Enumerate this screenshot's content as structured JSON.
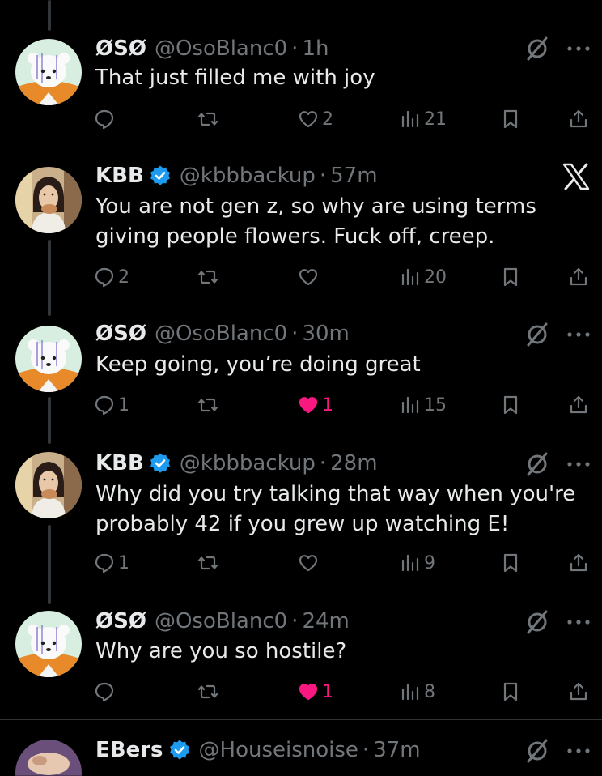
{
  "tweets": [
    {
      "name": "ØSØ",
      "handle": "@OsoBlanc0",
      "sep": "·",
      "time": "1h",
      "text": "That just filled me with joy",
      "replies": "",
      "retweets": "",
      "likes": "2",
      "liked": false,
      "views": "21",
      "corner_icon": "grok-icon"
    },
    {
      "name": "KBB",
      "handle": "@kbbbackup",
      "sep": "·",
      "time": "57m",
      "text": "You are not gen z, so why are using terms giving people flowers. Fuck off, creep.",
      "replies": "2",
      "retweets": "",
      "likes": "",
      "liked": false,
      "views": "20",
      "corner_icon": "x-logo-icon"
    },
    {
      "name": "ØSØ",
      "handle": "@OsoBlanc0",
      "sep": "·",
      "time": "30m",
      "text": "Keep going, you’re doing great",
      "replies": "1",
      "retweets": "",
      "likes": "1",
      "liked": true,
      "views": "15",
      "corner_icon": "grok-icon"
    },
    {
      "name": "KBB",
      "handle": "@kbbbackup",
      "sep": "·",
      "time": "28m",
      "text": "Why did you try talking that way when you're probably 42 if you grew up watching E!",
      "replies": "1",
      "retweets": "",
      "likes": "",
      "liked": false,
      "views": "9",
      "corner_icon": "grok-icon"
    },
    {
      "name": "ØSØ",
      "handle": "@OsoBlanc0",
      "sep": "·",
      "time": "24m",
      "text": "Why are you so hostile?",
      "replies": "",
      "retweets": "",
      "likes": "1",
      "liked": true,
      "views": "8",
      "corner_icon": "grok-icon"
    },
    {
      "name": "EBers",
      "handle": "@Houseisnoise",
      "sep": "·",
      "time": "37m",
      "text": "",
      "corner_icon": "grok-icon"
    }
  ],
  "colors": {
    "background": "#000000",
    "text": "#e7e9ea",
    "muted": "#71767b",
    "like_active": "#f91880",
    "verified_blue": "#1d9bf0",
    "divider": "#2f3336"
  }
}
